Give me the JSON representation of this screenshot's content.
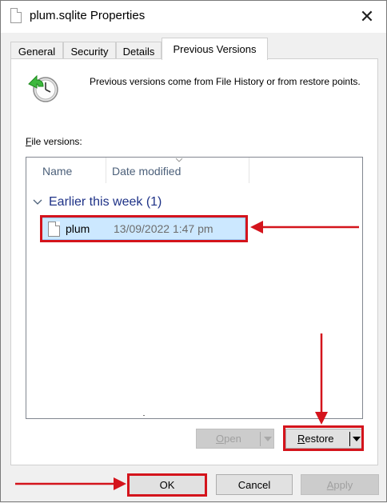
{
  "window": {
    "title": "plum.sqlite Properties",
    "close_symbol": "✕"
  },
  "tabs": [
    {
      "label": "General",
      "active": false
    },
    {
      "label": "Security",
      "active": false
    },
    {
      "label": "Details",
      "active": false
    },
    {
      "label": "Previous Versions",
      "active": true
    }
  ],
  "panel": {
    "info_text": "Previous versions come from File History or from restore points.",
    "file_versions_label_first": "F",
    "file_versions_label_rest": "ile versions:",
    "columns": {
      "name": "Name",
      "date_modified": "Date modified"
    },
    "group": {
      "label": "Earlier this week (1)"
    },
    "rows": [
      {
        "name": "plum",
        "date": "13/09/2022 1:47 pm",
        "selected": true
      }
    ],
    "open_button": {
      "label_u": "O",
      "label_rest": "pen",
      "disabled": true
    },
    "restore_button": {
      "label_u": "R",
      "label_rest": "estore",
      "disabled": false
    }
  },
  "footer": {
    "ok_label": "OK",
    "cancel_label": "Cancel",
    "apply_label_u": "A",
    "apply_label_rest": "pply",
    "apply_disabled": true
  },
  "colors": {
    "annotation_red": "#d4141c",
    "selection_bg": "#cce8ff",
    "group_text": "#1e3287",
    "column_header_text": "#4c607a"
  },
  "icons": {
    "title": "file-icon",
    "close": "close-icon",
    "history": "clock-restore-icon",
    "row": "file-icon"
  }
}
